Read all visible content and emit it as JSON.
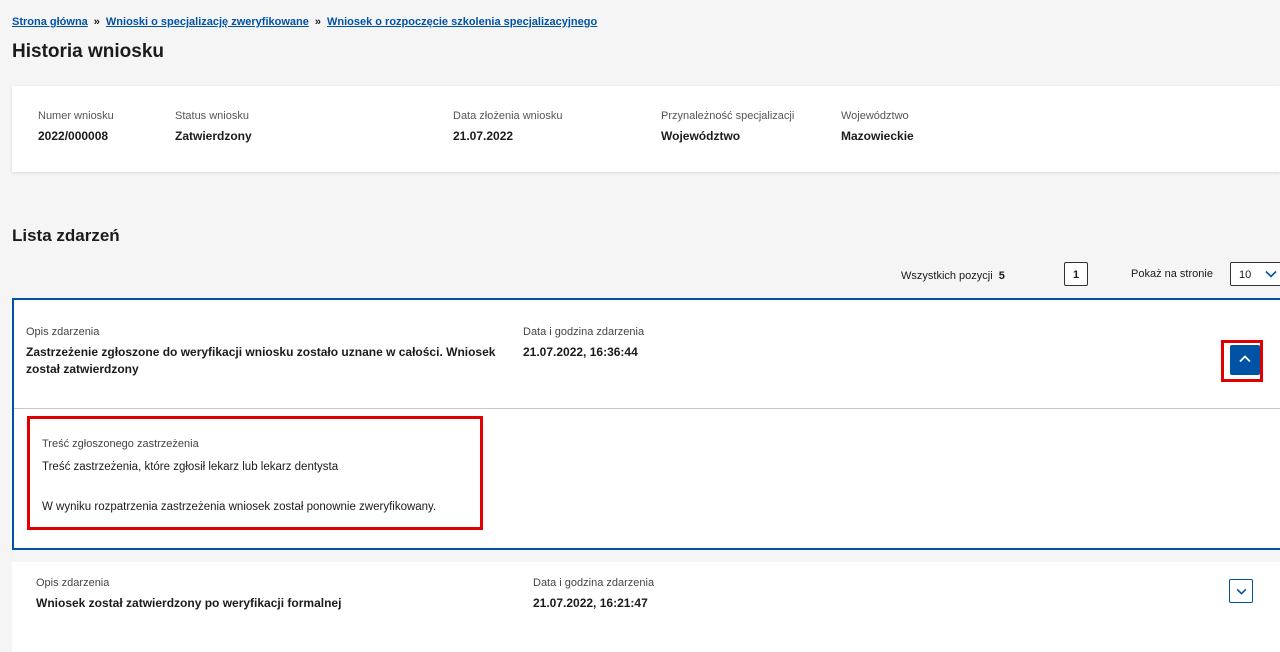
{
  "breadcrumb": {
    "items": [
      "Strona główna",
      "Wnioski o specjalizację zweryfikowane",
      "Wniosek o rozpoczęcie szkolenia specjalizacyjnego"
    ],
    "separator": "»"
  },
  "page_title": "Historia wniosku",
  "application": {
    "number_label": "Numer wniosku",
    "number": "2022/000008",
    "status_label": "Status wniosku",
    "status": "Zatwierdzony",
    "date_label": "Data złożenia wniosku",
    "date": "21.07.2022",
    "affiliation_label": "Przynależność specjalizacji",
    "affiliation": "Województwo",
    "voivodeship_label": "Województwo",
    "voivodeship": "Mazowieckie"
  },
  "events_section": {
    "title": "Lista zdarzeń",
    "total_label": "Wszystkich pozycji",
    "total": "5",
    "current_page": "1",
    "page_size_label": "Pokaż na stronie",
    "page_size": "10"
  },
  "events": [
    {
      "desc_label": "Opis zdarzenia",
      "desc": "Zastrzeżenie zgłoszone do weryfikacji wniosku zostało uznane w całości. Wniosek został zatwierdzony",
      "datetime_label": "Data i godzina zdarzenia",
      "datetime": "21.07.2022, 16:36:44",
      "expanded": true,
      "detail_label": "Treść zgłoszonego zastrzeżenia",
      "detail_line1": "Treść zastrzeżenia, które zgłosił lekarz lub lekarz dentysta",
      "detail_line2": "W wyniku rozpatrzenia zastrzeżenia wniosek został ponownie zweryfikowany."
    },
    {
      "desc_label": "Opis zdarzenia",
      "desc": "Wniosek został zatwierdzony po weryfikacji formalnej",
      "datetime_label": "Data i godzina zdarzenia",
      "datetime": "21.07.2022, 16:21:47",
      "expanded": false
    }
  ],
  "colors": {
    "link": "#0052a5",
    "accent": "#0052a5",
    "highlight": "#e00000",
    "background": "#f5f5f5"
  },
  "icons": {
    "collapse": "chevron-up-icon",
    "expand": "chevron-down-icon",
    "dropdown": "chevron-down-icon"
  }
}
